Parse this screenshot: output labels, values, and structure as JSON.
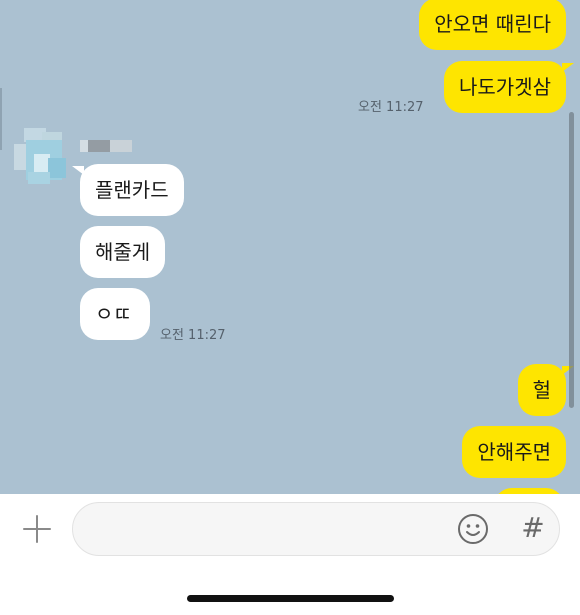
{
  "messages": {
    "m1": "안오면 때린다",
    "m2": "나도가겟삼",
    "t1": "오전 11:27",
    "o1": "플랜카드",
    "o2": "해줄게",
    "o3": "ㅇㄸ",
    "t2": "오전 11:27",
    "m3": "헐",
    "m4": "안해주면"
  },
  "input_bar": {
    "hash_label": "#"
  },
  "colors": {
    "chat_background": "#abc1d1",
    "my_bubble": "#fee500",
    "other_bubble": "#ffffff"
  }
}
